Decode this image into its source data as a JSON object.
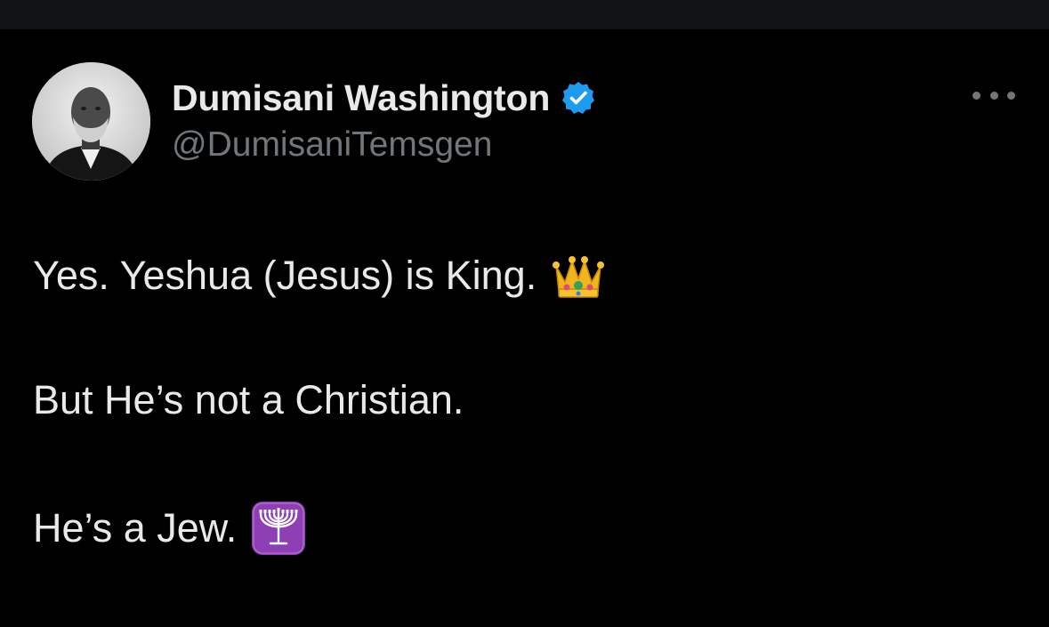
{
  "author": {
    "display_name": "Dumisani Washington",
    "handle": "@DumisaniTemsgen",
    "verified": true,
    "verified_color": "#1d9bf0"
  },
  "tweet": {
    "lines": [
      "Yes. Yeshua (Jesus) is King.",
      "But He’s not a Christian.",
      "He’s a Jew."
    ],
    "emojis": [
      "crown-emoji",
      "menorah-emoji"
    ]
  },
  "colors": {
    "background": "#000000",
    "text_primary": "#e7e9ea",
    "text_secondary": "#71767b",
    "menorah_tile": "#8e3fb3"
  }
}
